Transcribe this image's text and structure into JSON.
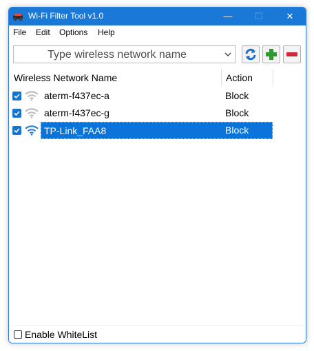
{
  "window": {
    "title": "Wi-Fi Filter Tool v1.0",
    "minimize": "—",
    "maximize": "☐",
    "close": "✕"
  },
  "menu": [
    {
      "label": "File"
    },
    {
      "label": "Edit"
    },
    {
      "label": "Options"
    },
    {
      "label": "Help"
    }
  ],
  "search": {
    "placeholder": "Type wireless network name"
  },
  "toolbar": {
    "refresh_icon": "refresh-icon",
    "add_icon": "plus-icon",
    "remove_icon": "minus-icon"
  },
  "table": {
    "headers": {
      "name": "Wireless Network Name",
      "action": "Action"
    },
    "rows": [
      {
        "checked": true,
        "name": "aterm-f437ec-a",
        "action": "Block",
        "selected": false
      },
      {
        "checked": true,
        "name": "aterm-f437ec-g",
        "action": "Block",
        "selected": false
      },
      {
        "checked": true,
        "name": "TP-Link_FAA8",
        "action": "Block",
        "selected": true
      }
    ]
  },
  "status": {
    "whitelist_label": "Enable WhiteList",
    "whitelist_checked": false
  },
  "colors": {
    "titlebar": "#1a78d6",
    "selection": "#0a74da",
    "checkbox": "#1773d0",
    "add": "#2e9b2e",
    "remove": "#d2263b"
  }
}
